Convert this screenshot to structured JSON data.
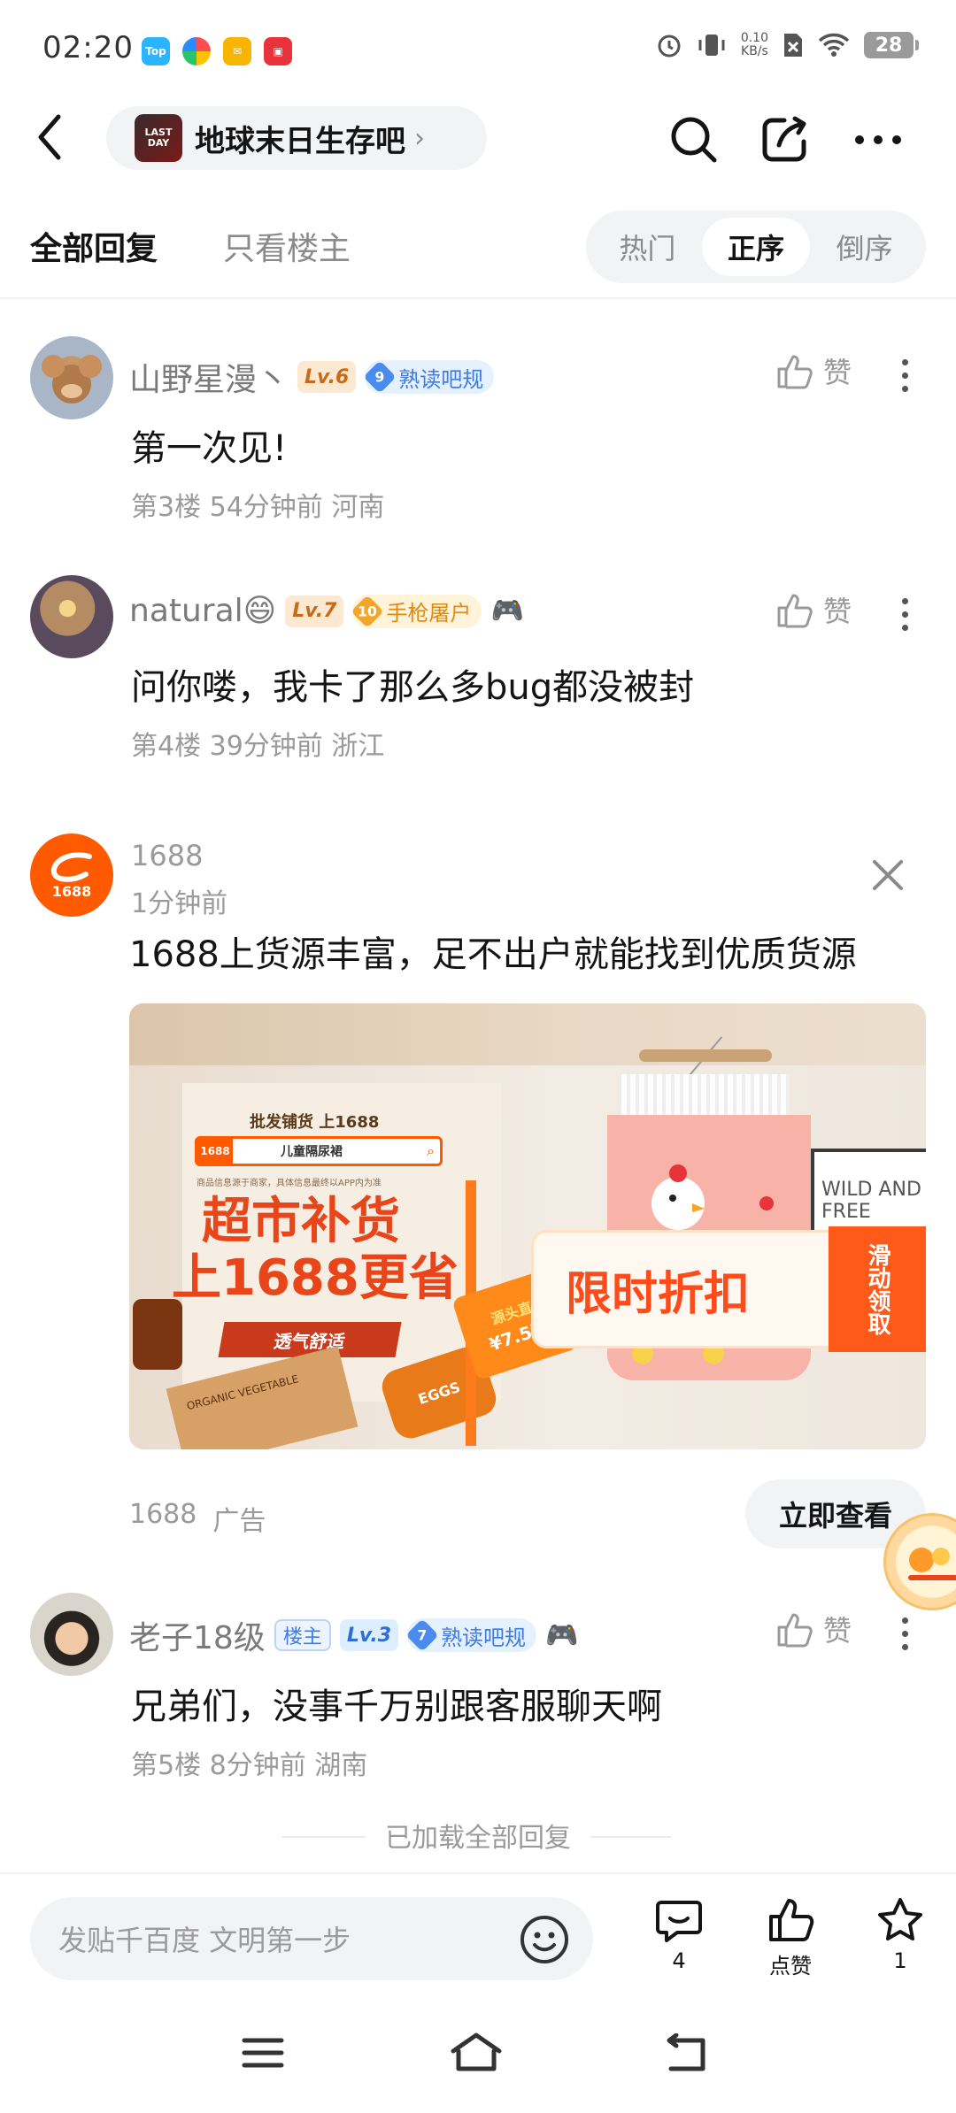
{
  "status_bar": {
    "time": "02:20",
    "apps": [
      {
        "label": "Top",
        "color": "#2bb5ff"
      },
      {
        "label": "",
        "color": "#ff6a3d"
      },
      {
        "label": "",
        "color": "#f7b500"
      },
      {
        "label": "",
        "color": "#e8333a"
      }
    ],
    "net_speed_value": "0.10",
    "net_speed_unit": "KB/s",
    "battery": "28"
  },
  "header": {
    "forum_logo_text": "LAST DAY",
    "forum_name": "地球末日生存吧"
  },
  "tabs": {
    "all_replies": "全部回复",
    "op_only": "只看楼主"
  },
  "sort": {
    "hot": "热门",
    "asc": "正序",
    "desc": "倒序"
  },
  "posts": [
    {
      "username": "山野星漫丶",
      "level": "Lv.6",
      "title_num": "9",
      "title": "熟读吧规",
      "text": "第一次见!",
      "meta": "第3楼 54分钟前 河南",
      "like": "赞"
    },
    {
      "username": "natural😄",
      "level": "Lv.7",
      "title_num": "10",
      "title": "手枪屠户",
      "text": "问你喽，我卡了那么多bug都没被封",
      "meta": "第4楼 39分钟前 浙江",
      "like": "赞"
    },
    {
      "username": "老子18级",
      "host_badge": "楼主",
      "level": "Lv.3",
      "title_num": "7",
      "title": "熟读吧规",
      "text": "兄弟们，没事千万别跟客服聊天啊",
      "meta": "第5楼 8分钟前 湖南",
      "like": "赞"
    }
  ],
  "ad": {
    "name": "1688",
    "logo_text": "1688",
    "time": "1分钟前",
    "text": "1688上货源丰富，足不出户就能找到优质货源",
    "image": {
      "top_line": "批发铺货 上1688",
      "search_text": "儿童隔尿裙",
      "small_note": "商品信息源于商家，具体信息最终以APP内为准",
      "headline1": "超市补货",
      "headline2": "上1688更省",
      "ribbon": "透气舒适",
      "tag_top": "源头直",
      "tag_price": "¥7.5起",
      "discount": "限时折扣",
      "side": "滑动领取",
      "wall_sign": "WILD AND FREE",
      "jar_label": "ORGANIC VEGETABLE",
      "egg_label": "EGGS"
    },
    "source": "1688",
    "ad_label": "广告",
    "button": "立即查看"
  },
  "footer_text": "已加载全部回复",
  "bottom_bar": {
    "placeholder": "发贴千百度 文明第一步",
    "comments_count": "4",
    "like_label": "点赞",
    "star_count": "1"
  }
}
